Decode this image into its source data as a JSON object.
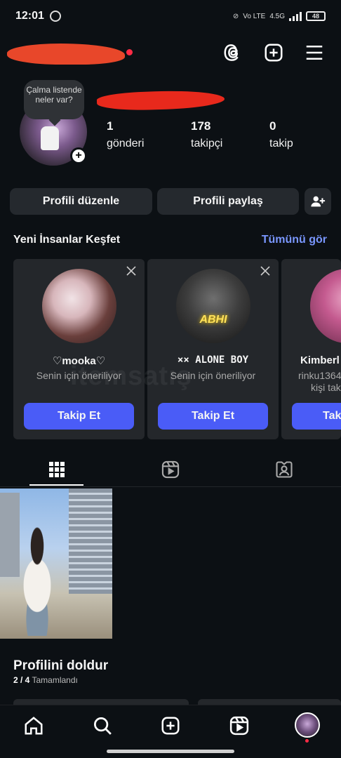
{
  "status_bar": {
    "time": "12:01",
    "network": "4.5G",
    "volte": "Vo LTE",
    "battery": "48"
  },
  "header": {
    "threads_icon": "threads-icon",
    "new_post_icon": "plus-square-icon",
    "menu_icon": "hamburger-menu-icon"
  },
  "profile": {
    "note_bubble": "Çalma listende neler var?",
    "stats": [
      {
        "value": "1",
        "label": "gönderi"
      },
      {
        "value": "178",
        "label": "takipçi"
      },
      {
        "value": "0",
        "label": "takip"
      }
    ],
    "edit_button": "Profili düzenle",
    "share_button": "Profili paylaş"
  },
  "discover": {
    "title": "Yeni İnsanlar Keşfet",
    "see_all": "Tümünü gör",
    "cards": [
      {
        "name": "♡mooka♡",
        "subtitle": "Senin için öneriliyor",
        "button": "Takip Et"
      },
      {
        "name": "×× ALONE BOY",
        "subtitle": "Senin için öneriliyor",
        "button": "Takip Et",
        "pic_text": "ABHI"
      },
      {
        "name": "Kimberl",
        "subtitle": "rinku1364",
        "subtitle2": "kişi tak",
        "button": "Tak"
      }
    ]
  },
  "tabs": [
    "grid-icon",
    "reels-icon",
    "tagged-icon"
  ],
  "complete_profile": {
    "title": "Profilini doldur",
    "progress_bold": "2 / 4",
    "progress_text": "Tamamlandı"
  },
  "watermark": "itemsatış",
  "bottom_nav": [
    "home-icon",
    "search-icon",
    "create-icon",
    "reels-icon",
    "profile-avatar"
  ]
}
